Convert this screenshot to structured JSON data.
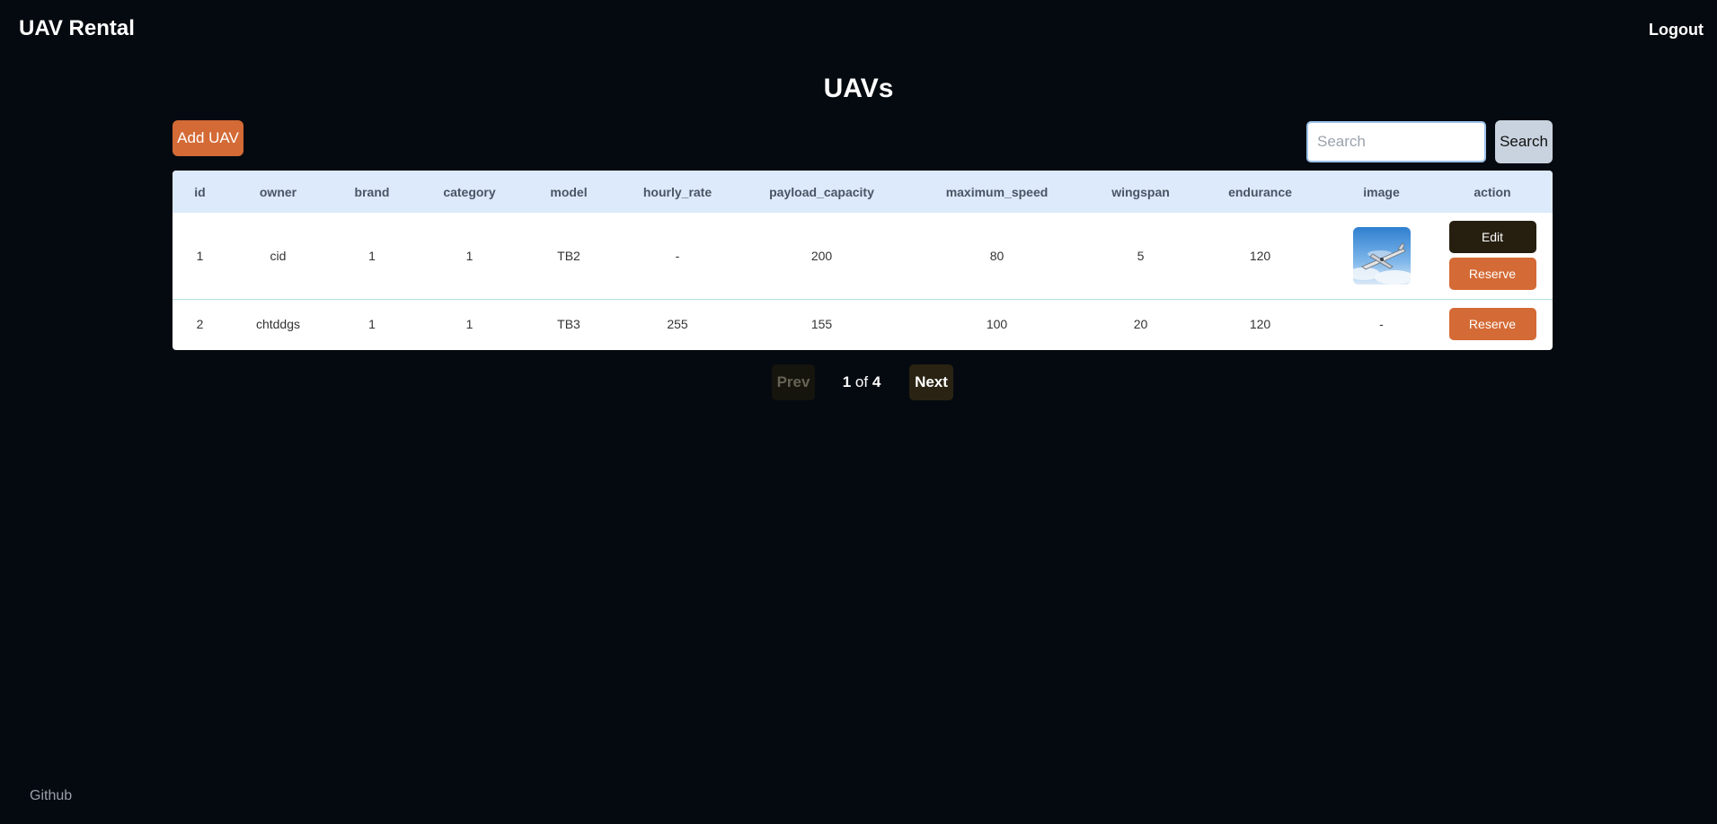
{
  "header": {
    "brand": "UAV Rental",
    "logout_label": "Logout"
  },
  "page": {
    "title": "UAVs"
  },
  "toolbar": {
    "add_label": "Add UAV",
    "search_placeholder": "Search",
    "search_value": "",
    "search_label": "Search"
  },
  "table": {
    "columns": [
      "id",
      "owner",
      "brand",
      "category",
      "model",
      "hourly_rate",
      "payload_capacity",
      "maximum_speed",
      "wingspan",
      "endurance",
      "image",
      "action"
    ],
    "rows": [
      {
        "id": "1",
        "owner": "cid",
        "brand": "1",
        "category": "1",
        "model": "TB2",
        "hourly_rate": "-",
        "payload_capacity": "200",
        "maximum_speed": "80",
        "wingspan": "5",
        "endurance": "120",
        "image": "uav-photo",
        "edit_label": "Edit",
        "reserve_label": "Reserve"
      },
      {
        "id": "2",
        "owner": "chtddgs",
        "brand": "1",
        "category": "1",
        "model": "TB3",
        "hourly_rate": "255",
        "payload_capacity": "155",
        "maximum_speed": "100",
        "wingspan": "20",
        "endurance": "120",
        "image": "-",
        "reserve_label": "Reserve"
      }
    ]
  },
  "pagination": {
    "prev_label": "Prev",
    "current": "1",
    "of_label": "of",
    "total": "4",
    "next_label": "Next"
  },
  "footer": {
    "github_label": "Github"
  },
  "colors": {
    "background": "#050a10",
    "accent": "#d46a35",
    "header_row": "#dceafc",
    "dark_button": "#261f10"
  }
}
